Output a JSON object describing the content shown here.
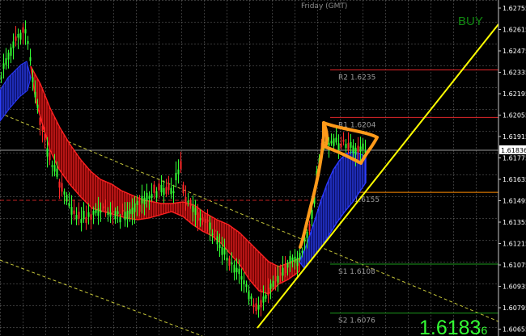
{
  "header": {
    "session_text": "Friday  (GMT)",
    "signal": "BUY"
  },
  "price_axis": {
    "labels": [
      "1.62755",
      "1.62615",
      "1.62475",
      "1.62335",
      "1.62195",
      "1.62055",
      "1.61915",
      "1.61775",
      "1.61635",
      "1.61495",
      "1.61355",
      "1.61215",
      "1.61075",
      "1.60935",
      "1.60795",
      "1.60655"
    ],
    "current_price": "1.61836"
  },
  "levels": [
    {
      "name": "R2",
      "label": "R2  1.6235",
      "price": 1.6235,
      "color": "#e0262a"
    },
    {
      "name": "R1",
      "label": "R1  1.6204",
      "price": 1.6204,
      "color": "#e0262a"
    },
    {
      "name": "FPV",
      "label": "FPV  1.6155",
      "price": 1.6155,
      "color": "#ff8c00"
    },
    {
      "name": "S1",
      "label": "S1  1.6108",
      "price": 1.6108,
      "color": "#1c9a1c"
    },
    {
      "name": "S2",
      "label": "S2  1.6076",
      "price": 1.6076,
      "color": "#1c9a1c"
    }
  ],
  "big_price": {
    "main": "1.6183",
    "small": "6"
  },
  "colors": {
    "bull": "#34ff34",
    "bear": "#ff2828",
    "ribbon_down": "#d81818",
    "ribbon_up": "#2030d8",
    "trendline": "#ffff00",
    "channel": "#c8c83a",
    "annotation": "#ff8c00",
    "grid": "#808080"
  }
}
